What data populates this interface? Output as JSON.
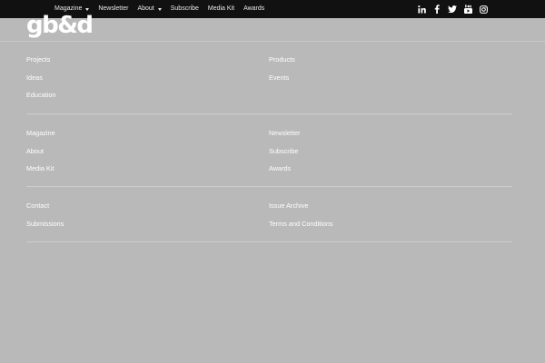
{
  "topnav": {
    "items": [
      {
        "label": "Magazine",
        "dropdown": true
      },
      {
        "label": "Newsletter",
        "dropdown": false
      },
      {
        "label": "About",
        "dropdown": true
      },
      {
        "label": "Subscribe",
        "dropdown": false
      },
      {
        "label": "Media Kit",
        "dropdown": false
      },
      {
        "label": "Awards",
        "dropdown": false
      }
    ],
    "social_icons": [
      "linkedin-icon",
      "facebook-icon",
      "twitter-icon",
      "youtube-icon",
      "instagram-icon"
    ]
  },
  "logo": {
    "text": "gb&d"
  },
  "footer": {
    "sections": [
      {
        "left": [
          "Projects",
          "Ideas",
          "Education"
        ],
        "right": [
          "Products",
          "Events"
        ]
      },
      {
        "left": [
          "Magazine",
          "About",
          "Media Kit"
        ],
        "right": [
          "Newsletter",
          "Subscribe",
          "Awards"
        ]
      },
      {
        "left": [
          "Contact",
          "Submissions"
        ],
        "right": [
          "Issue Archive",
          "Terms and Conditions"
        ]
      }
    ]
  },
  "colors": {
    "topbar_bg": "#111111",
    "page_bg": "#b9b9b9",
    "link_text": "#ffffff"
  }
}
